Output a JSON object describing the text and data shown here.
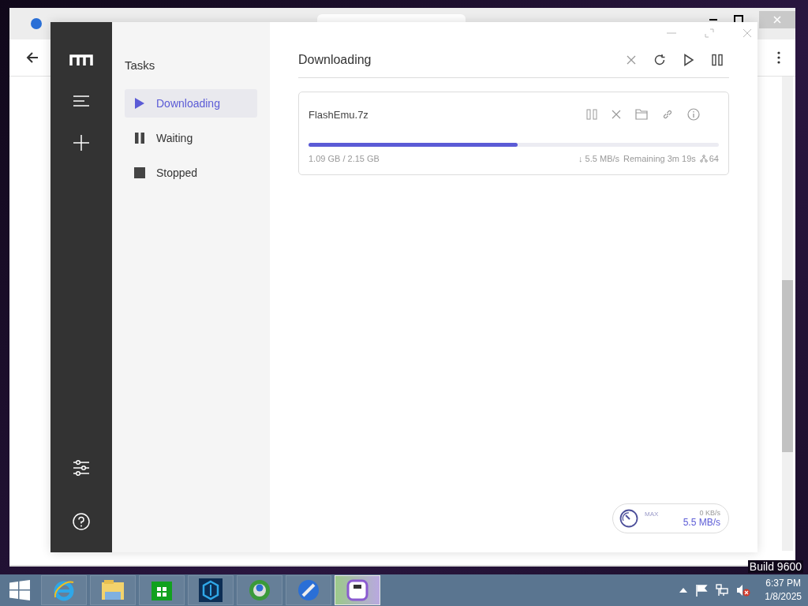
{
  "app": {
    "sidebar": {
      "title": "Tasks",
      "items": [
        {
          "label": "Downloading",
          "kind": "play",
          "selected": true
        },
        {
          "label": "Waiting",
          "kind": "pause",
          "selected": false
        },
        {
          "label": "Stopped",
          "kind": "stop",
          "selected": false
        }
      ]
    },
    "main": {
      "title": "Downloading",
      "tasks": [
        {
          "name": "FlashEmu.7z",
          "level": 0.51,
          "progress": "1.09 GB / 2.15 GB",
          "speed": "↓ 5.5 MB/s",
          "remaining": "Remaining 3m 19s",
          "connections": "64"
        }
      ]
    },
    "speedometer": {
      "label": "MAX",
      "upload": "0 KB/s",
      "download": "5.5 MB/s"
    }
  },
  "desktop": {
    "build": "Build 9600"
  },
  "taskbar": {
    "apps": [
      {
        "kind": "browser-e",
        "selected": false
      },
      {
        "kind": "folder",
        "selected": false
      },
      {
        "kind": "store",
        "selected": false
      },
      {
        "kind": "hexagon",
        "selected": false
      },
      {
        "kind": "globe",
        "selected": false
      },
      {
        "kind": "rocket",
        "selected": false
      },
      {
        "kind": "download",
        "selected": true
      }
    ],
    "time": "6:37 PM",
    "date": "1/8/2025"
  }
}
